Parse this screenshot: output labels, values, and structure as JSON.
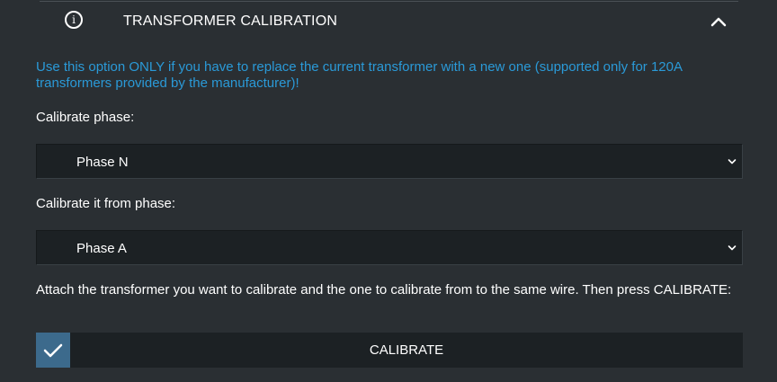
{
  "section": {
    "title": "TRANSFORMER CALIBRATION",
    "info_icon": "info-circle-icon",
    "collapse_icon": "chevron-up-icon"
  },
  "notice": {
    "text": "Use this option ONLY if you have to replace the current transformer with a new one (supported only for 120A transformers provided by the manufacturer)!",
    "color": "#2a9ad8"
  },
  "calibrate_phase": {
    "label": "Calibrate phase:",
    "selected": "Phase N"
  },
  "calibrate_from": {
    "label": "Calibrate it from phase:",
    "selected": "Phase A"
  },
  "instruction": {
    "text": "Attach the transformer you want to calibrate and the one to calibrate from to the same wire. Then press CALIBRATE:"
  },
  "calibrate_button": {
    "label": "CALIBRATE",
    "icon": "checkmark-icon",
    "accent": "#3c6a8c"
  }
}
